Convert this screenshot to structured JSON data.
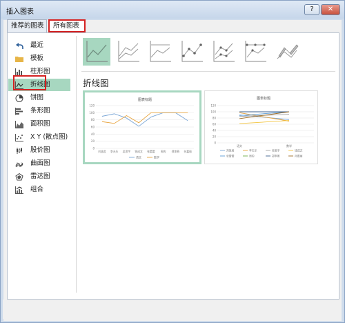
{
  "window": {
    "title": "插入图表",
    "help_label": "?",
    "close_label": "✕"
  },
  "tabs": [
    {
      "label": "推荐的图表"
    },
    {
      "label": "所有图表"
    }
  ],
  "sidebar": {
    "items": [
      {
        "label": "最近",
        "icon": "undo-icon"
      },
      {
        "label": "模板",
        "icon": "folder-icon"
      },
      {
        "label": "柱形图",
        "icon": "column-chart-icon"
      },
      {
        "label": "折线图",
        "icon": "line-chart-icon"
      },
      {
        "label": "饼图",
        "icon": "pie-chart-icon"
      },
      {
        "label": "条形图",
        "icon": "bar-chart-icon"
      },
      {
        "label": "面积图",
        "icon": "area-chart-icon"
      },
      {
        "label": "X Y (散点图)",
        "icon": "scatter-chart-icon"
      },
      {
        "label": "股价图",
        "icon": "stock-chart-icon"
      },
      {
        "label": "曲面图",
        "icon": "surface-chart-icon"
      },
      {
        "label": "雷达图",
        "icon": "radar-chart-icon"
      },
      {
        "label": "组合",
        "icon": "combo-chart-icon"
      }
    ]
  },
  "section_title": "折线图",
  "colors": {
    "accent_green": "#a7d7c0",
    "highlight_red": "#d42020",
    "series_blue": "#7aa6d6",
    "series_orange": "#e7a33c"
  },
  "previews": [
    {
      "chart_title": "图表标题",
      "categories": [
        "刘慧君",
        "李天乐",
        "吴思宇",
        "钱成文",
        "张蕾蕾",
        "周的",
        "郑李燕",
        "孙嘉丽"
      ],
      "legend": [
        "语文",
        "数学"
      ],
      "ylim": [
        0,
        120
      ],
      "y_ticks": [
        "0",
        "20",
        "40",
        "60",
        "80",
        "100",
        "120"
      ],
      "series": [
        {
          "name": "语文",
          "values": [
            90,
            97,
            85,
            62,
            88,
            100,
            100,
            78
          ]
        },
        {
          "name": "数学",
          "values": [
            75,
            70,
            92,
            72,
            100,
            100,
            100,
            100
          ]
        }
      ]
    },
    {
      "chart_title": "图表标题",
      "categories": [
        "语文",
        "数学"
      ],
      "ylim": [
        0,
        120
      ],
      "y_ticks": [
        "0",
        "20",
        "40",
        "60",
        "80",
        "100",
        "120"
      ],
      "legend": [
        "刘慧君",
        "李天乐",
        "吴思宇",
        "钱成文",
        "张蕾蕾",
        "周的",
        "郑李燕",
        "孙嘉丽"
      ]
    }
  ]
}
